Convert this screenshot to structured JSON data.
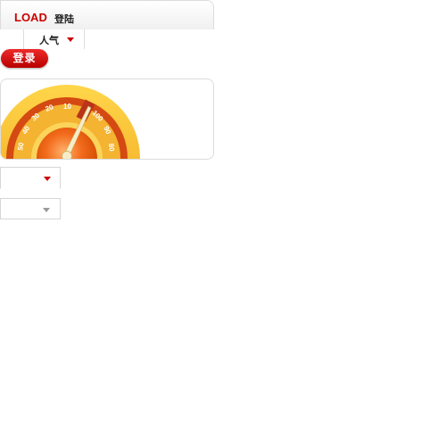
{
  "header": {
    "brand": "LOAD",
    "title": "登陆"
  },
  "filter": {
    "label": "人气"
  },
  "login_button": {
    "label": "登录"
  },
  "gauge": {
    "ticks": [
      "10",
      "20",
      "30",
      "40",
      "50",
      "100",
      "90",
      "80"
    ],
    "colors": {
      "outer": "#f5a623",
      "inner": "#e85a0c",
      "needle": "#f5e6b8"
    }
  },
  "dropdowns": [
    {
      "selected": ""
    },
    {
      "selected": ""
    }
  ],
  "colors": {
    "accent": "#cc0000",
    "border": "#dcdcdc"
  }
}
